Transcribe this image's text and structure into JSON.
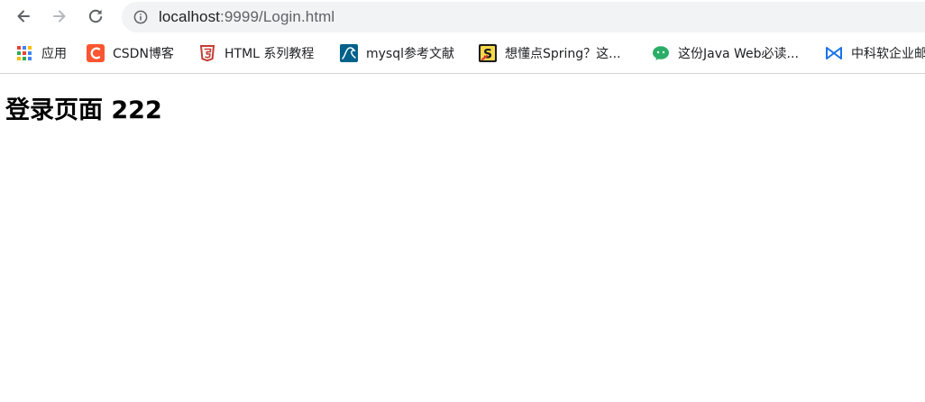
{
  "toolbar": {
    "back_icon": "arrow-left-icon",
    "forward_icon": "arrow-right-icon",
    "reload_icon": "reload-icon",
    "info_icon": "info-icon",
    "url_host": "localhost",
    "url_path": ":9999/Login.html"
  },
  "bookmarks": [
    {
      "label": "应用",
      "icon": "apps-grid-icon"
    },
    {
      "label": "CSDN博客",
      "icon": "csdn-icon"
    },
    {
      "label": "HTML 系列教程",
      "icon": "html5-icon"
    },
    {
      "label": "mysql参考文献",
      "icon": "mysql-icon"
    },
    {
      "label": "想懂点Spring？这...",
      "icon": "spring-icon"
    },
    {
      "label": "这份Java Web必读...",
      "icon": "wechat-icon"
    },
    {
      "label": "中科软企业邮",
      "icon": "bowtie-icon"
    }
  ],
  "colors": {
    "omnibox_bg": "#f1f3f4",
    "csdn_red": "#fc5531",
    "html_red": "#c33d36",
    "mysql_blue": "#00618a",
    "spring_yellow": "#f7d84a",
    "wechat_green": "#2aae67",
    "bowtie_blue": "#1a73e8"
  },
  "page": {
    "heading": "登录页面 222"
  }
}
